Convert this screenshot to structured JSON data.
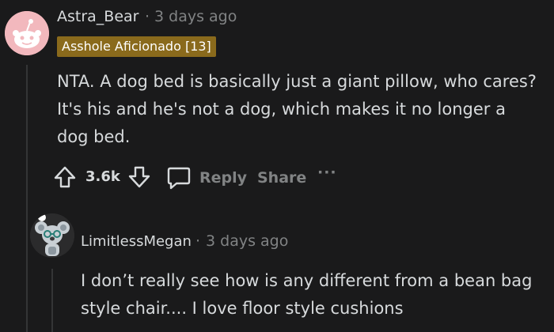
{
  "comment": {
    "author": "Astra_Bear",
    "separator": "·",
    "timestamp": "3 days ago",
    "flair": "Asshole Aficionado [13]",
    "body": "NTA. A dog bed is basically just a giant pillow, who cares?\nIt's his and he's not a dog, which makes it no longer a\ndog bed.",
    "score": "3.6k",
    "reply_label": "Reply",
    "share_label": "Share",
    "more_label": "···"
  },
  "reply": {
    "author": "LimitlessMegan",
    "separator": "·",
    "timestamp": "3 days ago",
    "body": "I don’t really see how is any different from a bean bag\nstyle chair.... I love floor style cushions"
  },
  "icons": {
    "upvote": "upvote-arrow-icon",
    "downvote": "downvote-arrow-icon",
    "reply": "speech-bubble-icon",
    "more": "ellipsis-icon"
  },
  "colors": {
    "background": "#1a1a1b",
    "text": "#d7dadc",
    "muted": "#818384",
    "flair": "#8a6a1c"
  }
}
